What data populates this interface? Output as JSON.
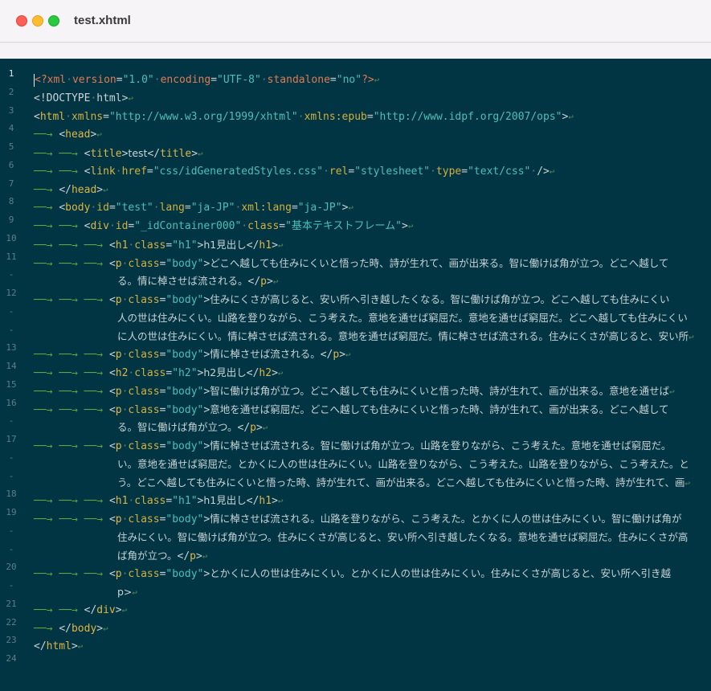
{
  "window": {
    "title": "test.xhtml"
  },
  "editor": {
    "line_numbers": [
      "1",
      "2",
      "3",
      "4",
      "5",
      "6",
      "7",
      "8",
      "9",
      "10",
      "11",
      "-",
      "12",
      "-",
      "-",
      "13",
      "14",
      "15",
      "16",
      "-",
      "17",
      "-",
      "-",
      "18",
      "19",
      "-",
      "-",
      "20",
      "-",
      "21",
      "22",
      "23",
      "24"
    ],
    "current_line": "1",
    "lines": [
      {
        "indent": 0,
        "text": "<?xml version=\"1.0\" encoding=\"UTF-8\" standalone=\"no\"?>"
      },
      {
        "indent": 0,
        "text": "<!DOCTYPE html>"
      },
      {
        "indent": 0,
        "text": "<html xmlns=\"http://www.w3.org/1999/xhtml\" xmlns:epub=\"http://www.idpf.org/2007/ops\">"
      },
      {
        "indent": 1,
        "text": "<head>"
      },
      {
        "indent": 2,
        "text": "<title>test</title>"
      },
      {
        "indent": 2,
        "text": "<link href=\"css/idGeneratedStyles.css\" rel=\"stylesheet\" type=\"text/css\" />"
      },
      {
        "indent": 1,
        "text": "</head>"
      },
      {
        "indent": 1,
        "text": "<body id=\"test\" lang=\"ja-JP\" xml:lang=\"ja-JP\">"
      },
      {
        "indent": 2,
        "text": "<div id=\"_idContainer000\" class=\"基本テキストフレーム\">"
      },
      {
        "indent": 3,
        "text": "<h1 class=\"h1\">h1見出し</h1>"
      },
      {
        "indent": 3,
        "text": "<p class=\"body\">どこへ越しても住みにくいと悟った時、詩が生れて、画が出来る。智に働けば角が立つ。どこへ越して"
      },
      {
        "indent": -1,
        "text": "る。情に棹させば流される。</p>"
      },
      {
        "indent": 3,
        "text": "<p class=\"body\">住みにくさが高じると、安い所へ引き越したくなる。智に働けば角が立つ。どこへ越しても住みにくい"
      },
      {
        "indent": -1,
        "text": "人の世は住みにくい。山路を登りながら、こう考えた。意地を通せば窮屈だ。意地を通せば窮屈だ。どこへ越しても住みにくい"
      },
      {
        "indent": -1,
        "text": "に人の世は住みにくい。情に棹させば流される。意地を通せば窮屈だ。情に棹させば流される。住みにくさが高じると、安い所"
      },
      {
        "indent": 3,
        "text": "<p class=\"body\">情に棹させば流される。</p>"
      },
      {
        "indent": 3,
        "text": "<h2 class=\"h2\">h2見出し</h2>"
      },
      {
        "indent": 3,
        "text": "<p class=\"body\">智に働けば角が立つ。どこへ越しても住みにくいと悟った時、詩が生れて、画が出来る。意地を通せば"
      },
      {
        "indent": 3,
        "text": "<p class=\"body\">意地を通せば窮屈だ。どこへ越しても住みにくいと悟った時、詩が生れて、画が出来る。どこへ越して"
      },
      {
        "indent": -1,
        "text": "る。智に働けば角が立つ。</p>"
      },
      {
        "indent": 3,
        "text": "<p class=\"body\">情に棹させば流される。智に働けば角が立つ。山路を登りながら、こう考えた。意地を通せば窮屈だ。"
      },
      {
        "indent": -1,
        "text": "い。意地を通せば窮屈だ。とかくに人の世は住みにくい。山路を登りながら、こう考えた。山路を登りながら、こう考えた。と"
      },
      {
        "indent": -1,
        "text": "う。どこへ越しても住みにくいと悟った時、詩が生れて、画が出来る。どこへ越しても住みにくいと悟った時、詩が生れて、画"
      },
      {
        "indent": 3,
        "text": "<h1 class=\"h1\">h1見出し</h1>"
      },
      {
        "indent": 3,
        "text": "<p class=\"body\">情に棹させば流される。山路を登りながら、こう考えた。とかくに人の世は住みにくい。智に働けば角が"
      },
      {
        "indent": -1,
        "text": "住みにくい。智に働けば角が立つ。住みにくさが高じると、安い所へ引き越したくなる。意地を通せば窮屈だ。住みにくさが高"
      },
      {
        "indent": -1,
        "text": "ば角が立つ。</p>"
      },
      {
        "indent": 3,
        "text": "<p class=\"body\">とかくに人の世は住みにくい。とかくに人の世は住みにくい。住みにくさが高じると、安い所へ引き越"
      },
      {
        "indent": -1,
        "text": "p>"
      },
      {
        "indent": 2,
        "text": "</div>"
      },
      {
        "indent": 1,
        "text": "</body>"
      },
      {
        "indent": 0,
        "text": "</html>"
      },
      {
        "indent": 0,
        "text": ""
      }
    ]
  },
  "colors": {
    "editor_background": "#023544",
    "tag": "#dfb545",
    "string": "#4cc0b6",
    "processing_instruction": "#e17a52",
    "whitespace_marker": "#5fa83f"
  },
  "icons": {
    "close": "close-window-icon",
    "minimize": "minimize-window-icon",
    "zoom": "zoom-window-icon",
    "tab_marker": "tab-arrow-icon",
    "line_end_marker": "return-icon"
  }
}
